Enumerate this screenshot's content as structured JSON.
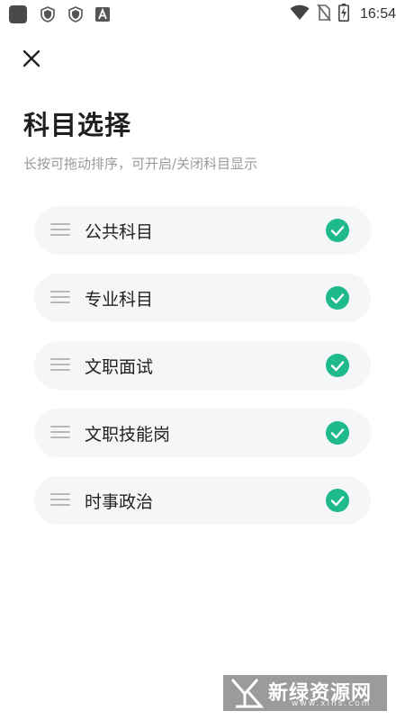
{
  "status_bar": {
    "time": "16:54",
    "icons": [
      "gallery-icon",
      "shield-icon",
      "shield-icon",
      "a-icon",
      "wifi-icon",
      "no-sim-icon",
      "battery-charging-icon"
    ]
  },
  "header": {
    "close_icon": "close-icon",
    "title": "科目选择",
    "subtitle": "长按可拖动排序，可开启/关闭科目显示"
  },
  "subjects": [
    {
      "label": "公共科目",
      "enabled": true
    },
    {
      "label": "专业科目",
      "enabled": true
    },
    {
      "label": "文职面试",
      "enabled": true
    },
    {
      "label": "文职技能岗",
      "enabled": true
    },
    {
      "label": "时事政治",
      "enabled": true
    }
  ],
  "watermark": {
    "text": "新绿资源网",
    "url": "www.xlhs.com"
  },
  "colors": {
    "check": "#1fba8c",
    "item_bg": "#f5f6f7",
    "subtitle": "#9a9a9a"
  }
}
